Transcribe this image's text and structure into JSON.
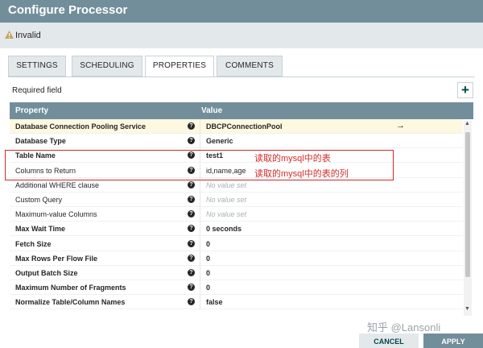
{
  "dialog": {
    "title": "Configure Processor"
  },
  "status": {
    "text": "Invalid",
    "icon": "warning-icon",
    "color": "#c4a35a"
  },
  "tabs": [
    {
      "label": "SETTINGS",
      "active": false
    },
    {
      "label": "SCHEDULING",
      "active": false
    },
    {
      "label": "PROPERTIES",
      "active": true
    },
    {
      "label": "COMMENTS",
      "active": false
    }
  ],
  "required_label": "Required field",
  "add_button": "+",
  "grid": {
    "headers": {
      "property": "Property",
      "value": "Value"
    },
    "rows": [
      {
        "name": "Database Connection Pooling Service",
        "value": "DBCPConnectionPool",
        "required": true,
        "has_value": true,
        "selected": true
      },
      {
        "name": "Database Type",
        "value": "Generic",
        "required": true,
        "has_value": true
      },
      {
        "name": "Table Name",
        "value": "test1",
        "required": true,
        "has_value": true
      },
      {
        "name": "Columns to Return",
        "value": "id,name,age",
        "required": false,
        "has_value": true
      },
      {
        "name": "Additional WHERE clause",
        "value": "No value set",
        "required": false,
        "has_value": false
      },
      {
        "name": "Custom Query",
        "value": "No value set",
        "required": false,
        "has_value": false
      },
      {
        "name": "Maximum-value Columns",
        "value": "No value set",
        "required": false,
        "has_value": false
      },
      {
        "name": "Max Wait Time",
        "value": "0 seconds",
        "required": true,
        "has_value": true
      },
      {
        "name": "Fetch Size",
        "value": "0",
        "required": true,
        "has_value": true
      },
      {
        "name": "Max Rows Per Flow File",
        "value": "0",
        "required": true,
        "has_value": true
      },
      {
        "name": "Output Batch Size",
        "value": "0",
        "required": true,
        "has_value": true
      },
      {
        "name": "Maximum Number of Fragments",
        "value": "0",
        "required": true,
        "has_value": true
      },
      {
        "name": "Normalize Table/Column Names",
        "value": "false",
        "required": true,
        "has_value": true
      }
    ]
  },
  "annotations": {
    "table_name": "读取的mysql中的表",
    "columns": "读取的mysql中的表的列",
    "color": "#d42a2a"
  },
  "watermark": "知乎 @Lansonli",
  "buttons": {
    "cancel": "CANCEL",
    "apply": "APPLY"
  }
}
